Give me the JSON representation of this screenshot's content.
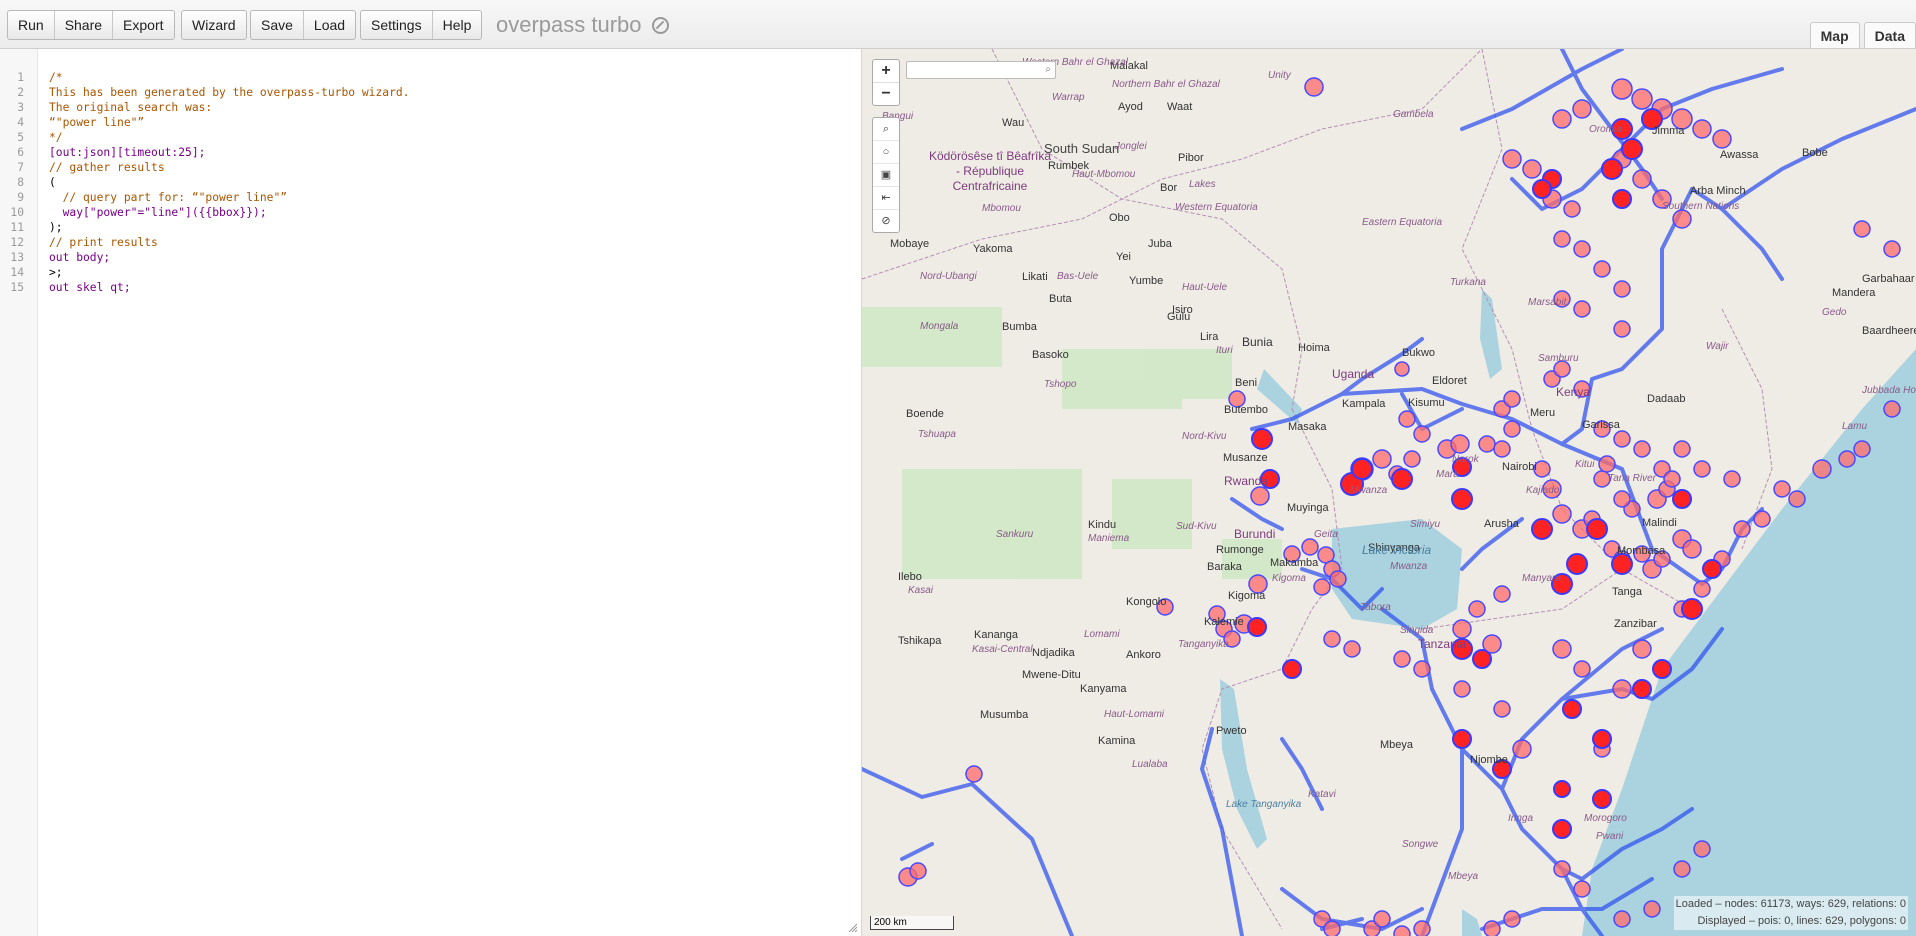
{
  "toolbar": {
    "buttons_group1": [
      "Run",
      "Share",
      "Export"
    ],
    "buttons_group2": [
      "Wizard"
    ],
    "buttons_group3": [
      "Save",
      "Load"
    ],
    "buttons_group4": [
      "Settings",
      "Help"
    ],
    "brand": "overpass turbo",
    "tabs": [
      "Map",
      "Data"
    ]
  },
  "editor": {
    "lines": [
      {
        "n": "1",
        "t": "/*"
      },
      {
        "n": "2",
        "t": "This has been generated by the overpass-turbo wizard."
      },
      {
        "n": "3",
        "t": "The original search was:"
      },
      {
        "n": "4",
        "t": "“\"power line\"”"
      },
      {
        "n": "5",
        "t": "*/"
      },
      {
        "n": "6",
        "t": "[out:json][timeout:25];"
      },
      {
        "n": "7",
        "t": "// gather results"
      },
      {
        "n": "8",
        "t": "("
      },
      {
        "n": "9",
        "t": "  // query part for: “\"power line\"”"
      },
      {
        "n": "10",
        "t": "  way[\"power\"=\"line\"]({{bbox}});"
      },
      {
        "n": "11",
        "t": ");"
      },
      {
        "n": "12",
        "t": "// print results"
      },
      {
        "n": "13",
        "t": "out body;"
      },
      {
        "n": "14",
        "t": ">;"
      },
      {
        "n": "15",
        "t": "out skel qt;"
      }
    ]
  },
  "map": {
    "zoom_in": "+",
    "zoom_out": "−",
    "scale": "200 km",
    "stats_loaded": "Loaded – nodes: 61173, ways: 629, relations: 0",
    "stats_displayed": "Displayed – pois: 0, lines: 629, polygons: 0",
    "places": [
      {
        "name": "Malakal"
      },
      {
        "name": "Ayod"
      },
      {
        "name": "Waat"
      },
      {
        "name": "Wau"
      },
      {
        "name": "South Sudan"
      },
      {
        "name": "Jonglei"
      },
      {
        "name": "Pibor"
      },
      {
        "name": "Rumbek"
      },
      {
        "name": "Bor"
      },
      {
        "name": "Juba"
      },
      {
        "name": "Yei"
      },
      {
        "name": "Yumbe"
      },
      {
        "name": "Gulu"
      },
      {
        "name": "Lira"
      },
      {
        "name": "Obo"
      },
      {
        "name": "Mobaye"
      },
      {
        "name": "Yakoma"
      },
      {
        "name": "Likati"
      },
      {
        "name": "Buta"
      },
      {
        "name": "Isiro"
      },
      {
        "name": "Bumba"
      },
      {
        "name": "Basoko"
      },
      {
        "name": "Bunia"
      },
      {
        "name": "Hoima"
      },
      {
        "name": "Beni"
      },
      {
        "name": "Butembo"
      },
      {
        "name": "Uganda"
      },
      {
        "name": "Kampala"
      },
      {
        "name": "Bukwo"
      },
      {
        "name": "Eldoret"
      },
      {
        "name": "Kisumu"
      },
      {
        "name": "Kenya"
      },
      {
        "name": "Meru"
      },
      {
        "name": "Garissa"
      },
      {
        "name": "Dadaab"
      },
      {
        "name": "Nairobi"
      },
      {
        "name": "Narok"
      },
      {
        "name": "Kitui"
      },
      {
        "name": "Masaka"
      },
      {
        "name": "Musanze"
      },
      {
        "name": "Rwanda"
      },
      {
        "name": "Muyinga"
      },
      {
        "name": "Burundi"
      },
      {
        "name": "Rumonge"
      },
      {
        "name": "Baraka"
      },
      {
        "name": "Makamba"
      },
      {
        "name": "Mwanza"
      },
      {
        "name": "Shinyanga"
      },
      {
        "name": "Arusha"
      },
      {
        "name": "Mombasa"
      },
      {
        "name": "Malindi"
      },
      {
        "name": "Tanga"
      },
      {
        "name": "Zanzibar"
      },
      {
        "name": "Tanzania"
      },
      {
        "name": "Kigoma"
      },
      {
        "name": "Kalemie"
      },
      {
        "name": "Kongolo"
      },
      {
        "name": "Kindu"
      },
      {
        "name": "Boende"
      },
      {
        "name": "Ilebo"
      },
      {
        "name": "Tshikapa"
      },
      {
        "name": "Kananga"
      },
      {
        "name": "Ndjadika"
      },
      {
        "name": "Mwene-Ditu"
      },
      {
        "name": "Kanyama"
      },
      {
        "name": "Musumba"
      },
      {
        "name": "Kamina"
      },
      {
        "name": "Pweto"
      },
      {
        "name": "Mbeya"
      },
      {
        "name": "Njombe"
      },
      {
        "name": "Ankoro"
      },
      {
        "name": "Arba Minch"
      },
      {
        "name": "Bobe"
      },
      {
        "name": "Awassa"
      },
      {
        "name": "Jimma"
      },
      {
        "name": "Mandera"
      },
      {
        "name": "Garbahaar"
      },
      {
        "name": "Baardheere"
      }
    ],
    "regions": [
      "Western Bahr el Ghazal",
      "Northern Bahr el Ghazal",
      "Warrap",
      "Unity",
      "Gambela",
      "Oromia",
      "Lakes",
      "Western Equatoria",
      "Eastern Equatoria",
      "Haut-Mbomou",
      "Mbomou",
      "Nord-Ubangi",
      "Bas-Uele",
      "Haut-Uele",
      "Mongala",
      "Tshopo",
      "Ituri",
      "Tshuapa",
      "Nord-Kivu",
      "Sud-Kivu",
      "Maniema",
      "Sankuru",
      "Kasai",
      "Kasai-Central",
      "Lomami",
      "Tanganyika",
      "Haut-Lomami",
      "Lualaba",
      "Kigoma",
      "Tabora",
      "Singida",
      "Geita",
      "Simiyu",
      "Mara",
      "Manyara",
      "Kajiado",
      "Tana River",
      "Marsabit",
      "Turkana",
      "Samburu",
      "Wajir",
      "Gedo",
      "Lamu",
      "Mwanza",
      "Katavi",
      "Morogoro",
      "Pwani",
      "Songwe",
      "Iringa",
      "Mbeya",
      "Jubbada Hoose",
      "Southern Nations",
      "Bangui"
    ],
    "country_label": "Ködörösêse tî Bêafrîka\n- République Centrafricaine",
    "water_label": "Lake Victoria",
    "lake_tanganyika": "Lake Tanganyika"
  }
}
